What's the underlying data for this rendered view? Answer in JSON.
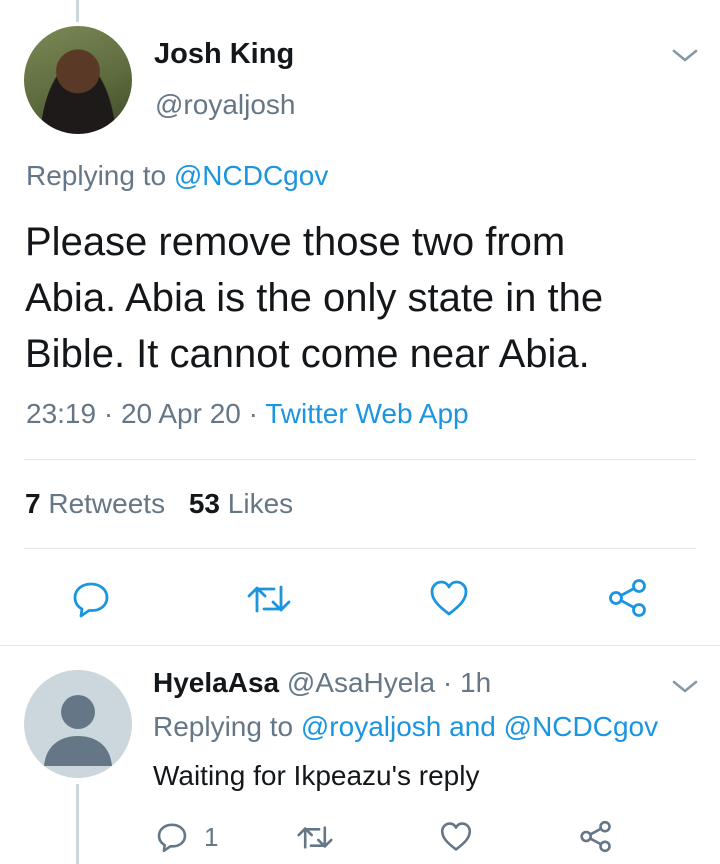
{
  "main_tweet": {
    "display_name": "Josh King",
    "handle": "@royaljosh",
    "replying_prefix": "Replying to",
    "replying_to": "@NCDCgov",
    "text_lines": [
      "Please remove those two from",
      "Abia. Abia is the only state in the",
      "Bible. It cannot come near Abia."
    ],
    "time": "23:19",
    "date": "20 Apr 20",
    "separator": "·",
    "source": "Twitter Web App",
    "retweets_count": "7",
    "retweets_label": "Retweets",
    "likes_count": "53",
    "likes_label": "Likes"
  },
  "reply": {
    "display_name": "HyelaAsa",
    "handle": "@AsaHyela",
    "separator": "·",
    "age": "1h",
    "replying_prefix": "Replying to",
    "replying_to_1": "@royaljosh",
    "conjunction": "and",
    "replying_to_2": "@NCDCgov",
    "text": "Waiting for Ikpeazu's reply",
    "reply_count": "1"
  },
  "colors": {
    "link": "#1b95e0",
    "secondary_text": "#657786",
    "primary_text": "#14171a",
    "divider": "#e1e8ed",
    "thread_line": "#ccd6dd"
  },
  "icons": {
    "menu": "chevron-down-icon",
    "reply": "reply-icon",
    "retweet": "retweet-icon",
    "like": "heart-icon",
    "share": "share-icon",
    "default_avatar": "default-avatar-icon"
  }
}
